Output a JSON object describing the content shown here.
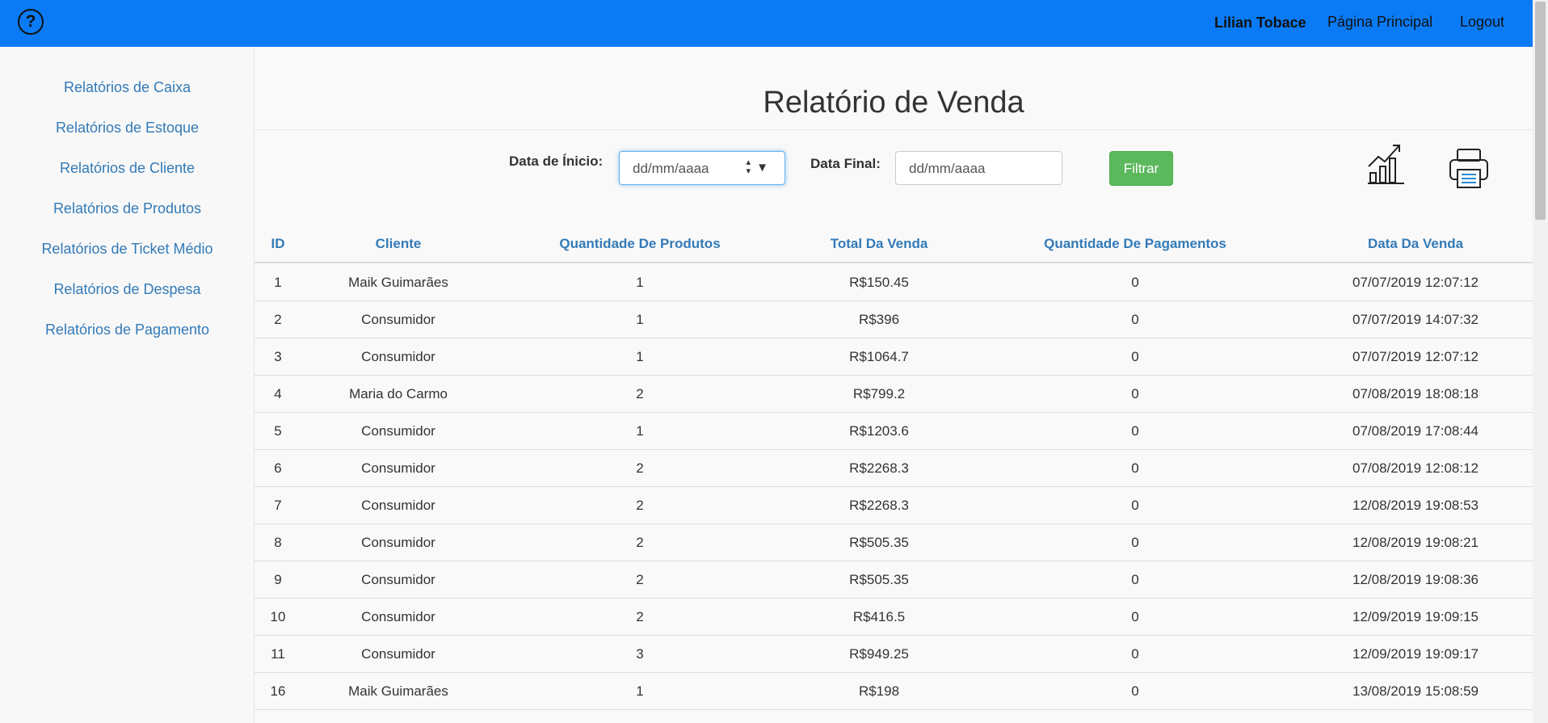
{
  "header": {
    "user_name": "Lilian Tobace",
    "home_label": "Página Principal",
    "logout_label": "Logout"
  },
  "sidebar": {
    "items": [
      {
        "label": "Relatórios de Caixa"
      },
      {
        "label": "Relatórios de Estoque"
      },
      {
        "label": "Relatórios de Cliente"
      },
      {
        "label": "Relatórios de Produtos"
      },
      {
        "label": "Relatórios de Ticket Médio"
      },
      {
        "label": "Relatórios de Despesa"
      },
      {
        "label": "Relatórios de Pagamento"
      }
    ]
  },
  "main": {
    "title": "Relatório de Venda",
    "filters": {
      "start_label": "Data de Ínicio:",
      "start_placeholder": "dd/mm/aaaa",
      "end_label": "Data Final:",
      "end_placeholder": "dd/mm/aaaa",
      "filter_button": "Filtrar"
    }
  },
  "table": {
    "headers": [
      "ID",
      "Cliente",
      "Quantidade De Produtos",
      "Total Da Venda",
      "Quantidade De Pagamentos",
      "Data Da Venda"
    ],
    "rows": [
      [
        "1",
        "Maik Guimarães",
        "1",
        "R$150.45",
        "0",
        "07/07/2019 12:07:12"
      ],
      [
        "2",
        "Consumidor",
        "1",
        "R$396",
        "0",
        "07/07/2019 14:07:32"
      ],
      [
        "3",
        "Consumidor",
        "1",
        "R$1064.7",
        "0",
        "07/07/2019 12:07:12"
      ],
      [
        "4",
        "Maria do Carmo",
        "2",
        "R$799.2",
        "0",
        "07/08/2019 18:08:18"
      ],
      [
        "5",
        "Consumidor",
        "1",
        "R$1203.6",
        "0",
        "07/08/2019 17:08:44"
      ],
      [
        "6",
        "Consumidor",
        "2",
        "R$2268.3",
        "0",
        "07/08/2019 12:08:12"
      ],
      [
        "7",
        "Consumidor",
        "2",
        "R$2268.3",
        "0",
        "12/08/2019 19:08:53"
      ],
      [
        "8",
        "Consumidor",
        "2",
        "R$505.35",
        "0",
        "12/08/2019 19:08:21"
      ],
      [
        "9",
        "Consumidor",
        "2",
        "R$505.35",
        "0",
        "12/08/2019 19:08:36"
      ],
      [
        "10",
        "Consumidor",
        "2",
        "R$416.5",
        "0",
        "12/09/2019 19:09:15"
      ],
      [
        "11",
        "Consumidor",
        "3",
        "R$949.25",
        "0",
        "12/09/2019 19:09:17"
      ],
      [
        "16",
        "Maik Guimarães",
        "1",
        "R$198",
        "0",
        "13/08/2019 15:08:59"
      ]
    ]
  },
  "icons": {
    "help": "question-circle-icon",
    "chart": "chart-growth-icon",
    "print": "printer-icon"
  },
  "colors": {
    "topbar": "#0a7bf5",
    "link": "#337ab7",
    "filter_button": "#5cb85c"
  }
}
